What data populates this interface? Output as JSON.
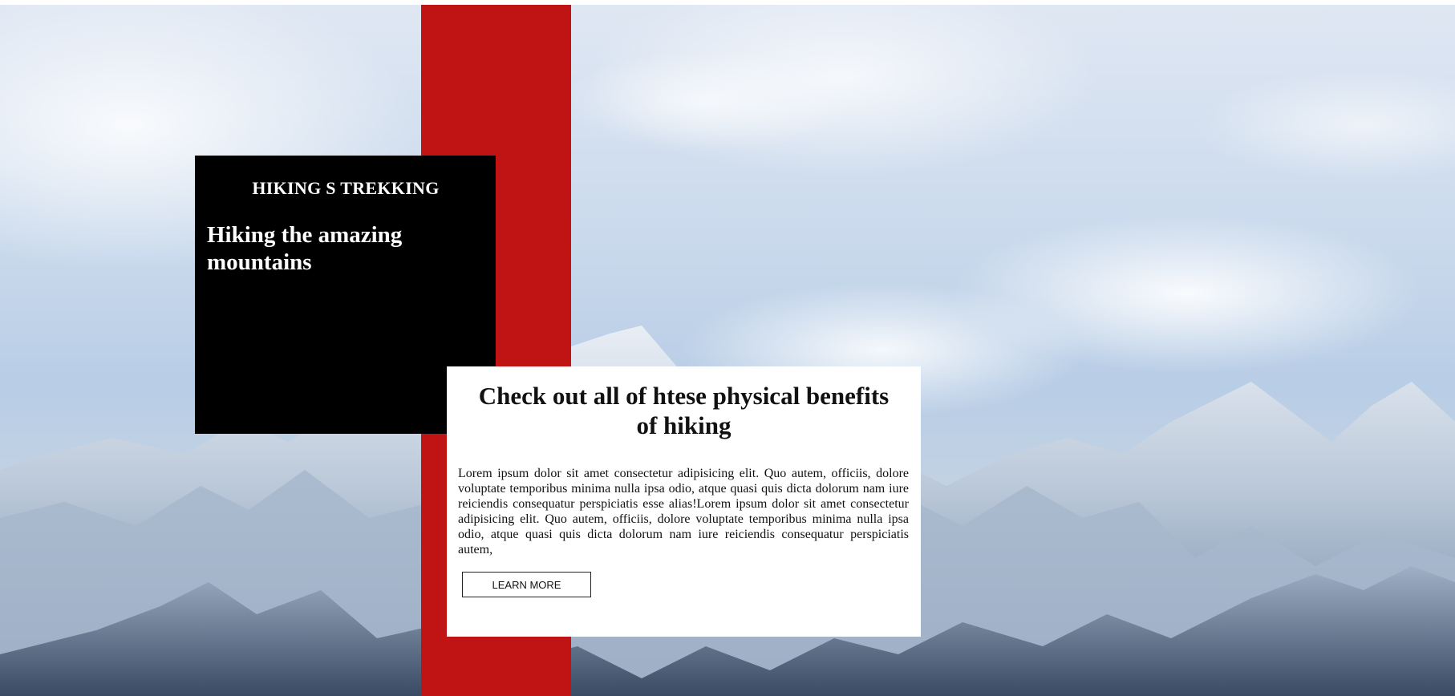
{
  "hero": {
    "background": "snowy-mountain-range-photo",
    "accent_color": "#c01414"
  },
  "black_card": {
    "kicker": "HIKING S TREKKING",
    "headline": "Hiking the amazing mountains"
  },
  "white_card": {
    "title": "Check out all of htese physical benefits of hiking",
    "body": "Lorem ipsum dolor sit amet consectetur adipisicing elit. Quo autem, officiis, dolore voluptate temporibus minima nulla ipsa odio, atque quasi quis dicta dolorum nam iure reiciendis consequatur perspiciatis esse alias!Lorem ipsum dolor sit amet consectetur adipisicing elit. Quo autem, officiis, dolore voluptate temporibus minima nulla ipsa odio, atque quasi quis dicta dolorum nam iure reiciendis consequatur perspiciatis autem,",
    "button_label": "LEARN MORE"
  }
}
